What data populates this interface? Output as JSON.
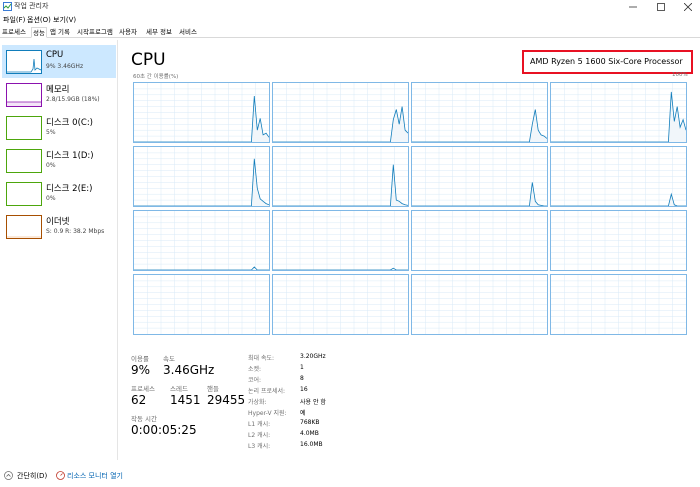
{
  "window": {
    "title": "작업 관리자"
  },
  "menu": [
    "파일(F)",
    "옵션(O)",
    "보기(V)"
  ],
  "tabs": [
    "프로세스",
    "성능",
    "앱 기록",
    "시작프로그램",
    "사용자",
    "세부 정보",
    "서비스"
  ],
  "active_tab": "성능",
  "sidebar": [
    {
      "title": "CPU",
      "sub": "9% 3.46GHz",
      "color": "#117dbb"
    },
    {
      "title": "메모리",
      "sub": "2.8/15.9GB (18%)",
      "color": "#8b12ae"
    },
    {
      "title": "디스크 0(C:)",
      "sub": "5%",
      "color": "#4da60c"
    },
    {
      "title": "디스크 1(D:)",
      "sub": "0%",
      "color": "#4da60c"
    },
    {
      "title": "디스크 2(E:)",
      "sub": "0%",
      "color": "#4da60c"
    },
    {
      "title": "이더넷",
      "sub": "S: 0.9  R: 38.2 Mbps",
      "color": "#a74f01"
    }
  ],
  "main": {
    "title": "CPU",
    "processor": "AMD Ryzen 5 1600 Six-Core Processor",
    "axis_label": "60초 간 이용률(%)",
    "axis_max": "100%"
  },
  "stats": {
    "utilization_label": "이용률",
    "utilization": "9%",
    "speed_label": "속도",
    "speed": "3.46GHz",
    "processes_label": "프로세스",
    "processes": "62",
    "threads_label": "스레드",
    "threads": "1451",
    "handles_label": "핸들",
    "handles": "29455",
    "uptime_label": "작동 시간",
    "uptime": "0:00:05:25"
  },
  "specs": [
    {
      "label": "최대 속도:",
      "value": "3.20GHz"
    },
    {
      "label": "소켓:",
      "value": "1"
    },
    {
      "label": "코어:",
      "value": "8"
    },
    {
      "label": "논리 프로세서:",
      "value": "16"
    },
    {
      "label": "가상화:",
      "value": "사용 안 함"
    },
    {
      "label": "Hyper-V 지원:",
      "value": "예"
    },
    {
      "label": "L1 캐시:",
      "value": "768KB"
    },
    {
      "label": "L2 캐시:",
      "value": "4.0MB"
    },
    {
      "label": "L3 캐시:",
      "value": "16.0MB"
    }
  ],
  "footer": {
    "summary": "간단히(D)",
    "resource_monitor": "리소스 모니터 열기"
  },
  "colors": {
    "cpu_line": "#117dbb",
    "cpu_fill": "#f1f6fa",
    "grid": "#d9eaf7",
    "highlight": "#e81123"
  }
}
